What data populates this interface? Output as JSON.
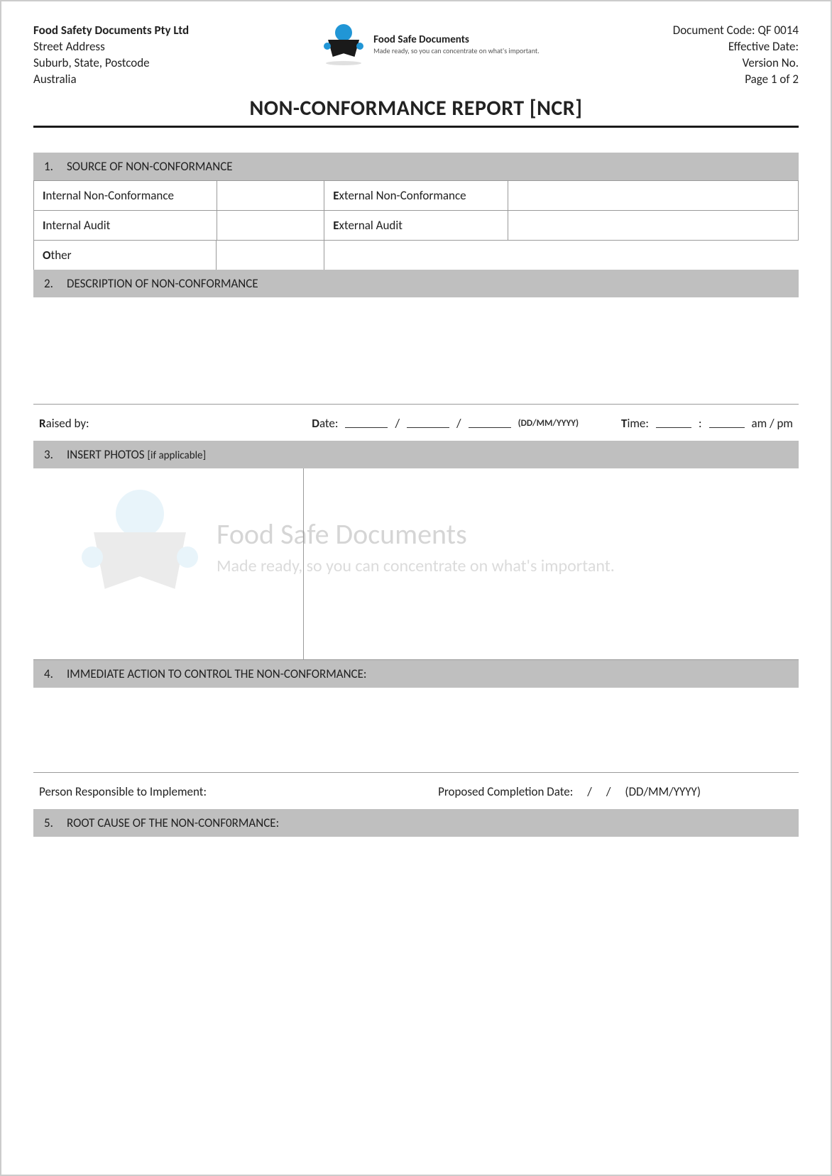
{
  "header": {
    "company": "Food Safety Documents Pty Ltd",
    "addr1": "Street Address",
    "addr2": "Suburb, State, Postcode",
    "addr3": "Australia",
    "logo_title": "Food Safe Documents",
    "logo_sub": "Made ready, so you can concentrate on what's important.",
    "doc_code": "Document Code: QF 0014",
    "eff_date": "Effective Date:",
    "version": "Version No.",
    "page": "Page 1 of 2"
  },
  "title": "NON-CONFORMANCE REPORT [NCR]",
  "sections": {
    "s1": {
      "num": "1.",
      "title": "SOURCE OF NON-CONFORMANCE"
    },
    "s2": {
      "num": "2.",
      "title": "DESCRIPTION OF NON-CONFORMANCE"
    },
    "s3": {
      "num": "3.",
      "title": "INSERT PHOTOS",
      "suffix": "[if applicable]"
    },
    "s4": {
      "num": "4.",
      "title": "IMMEDIATE ACTION TO CONTROL THE NON-CONFORMANCE:"
    },
    "s5": {
      "num": "5.",
      "title": "ROOT CAUSE OF THE NON-CONF0RMANCE:"
    }
  },
  "source_grid": {
    "r1c1": "nternal Non-Conformance",
    "r1c1f": "I",
    "r1c3": "xternal Non-Conformance",
    "r1c3f": "E",
    "r2c1": "nternal Audit",
    "r2c1f": "I",
    "r2c3": "xternal Audit",
    "r2c3f": "E",
    "r3c1": "ther",
    "r3c1f": "O"
  },
  "desc_meta": {
    "raised": "aised by:",
    "raised_f": "R",
    "date": "ate:",
    "date_f": "D",
    "date_hint": "(DD/MM/YYYY)",
    "time": "ime:",
    "time_f": "T",
    "ampm": "am  /  pm"
  },
  "action_meta": {
    "person": "erson Responsible to Implement:",
    "person_f": "P",
    "prop": "roposed Completion Date:",
    "prop_f": "P",
    "date_hint": "(DD/MM/YYYY)"
  },
  "watermark": {
    "l1": "Food Safe Documents",
    "l2": "Made ready, so you can concentrate on what's important."
  },
  "slash": "/",
  "colon": ":"
}
